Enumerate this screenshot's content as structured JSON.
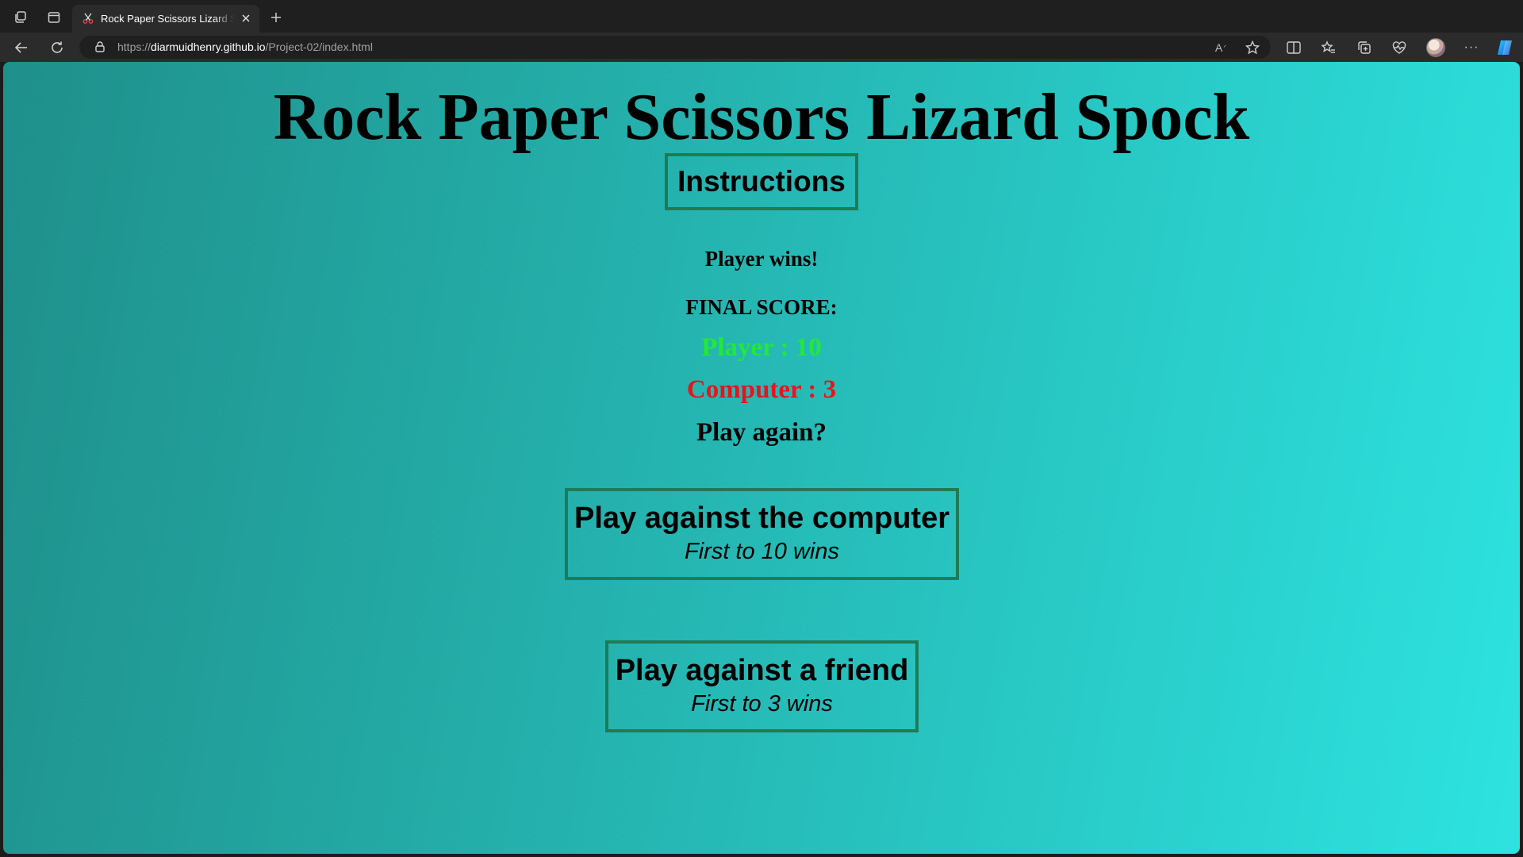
{
  "browser": {
    "tab_title": "Rock Paper Scissors Lizard Spock",
    "url_scheme": "https://",
    "url_host": "diarmuidhenry.github.io",
    "url_path": "/Project-02/index.html",
    "icons": {
      "workspaces": "workspaces-icon",
      "tab_actions": "tab-actions-icon",
      "new_tab": "+",
      "close_tab": "×",
      "back": "←",
      "refresh": "↻",
      "read_aloud": "A",
      "favorite": "☆",
      "split_screen": "split-screen-icon",
      "favorites": "favorites-icon",
      "collections": "collections-icon",
      "performance": "heart-pulse-icon",
      "more": "···"
    }
  },
  "page": {
    "title": "Rock Paper Scissors Lizard Spock",
    "instructions_label": "Instructions",
    "result_text": "Player wins!",
    "final_score_label": "FINAL SCORE:",
    "player_score_text": "Player : 10",
    "computer_score_text": "Computer : 3",
    "play_again_text": "Play again?",
    "modes": [
      {
        "title": "Play against the computer",
        "subtitle": "First to 10 wins"
      },
      {
        "title": "Play against a friend",
        "subtitle": "First to 3 wins"
      }
    ]
  },
  "scores": {
    "player": 10,
    "computer": 3
  },
  "colors": {
    "player_score": "#22e83a",
    "computer_score": "#e8141c",
    "button_border": "#227a55",
    "background_start": "#1f8f8a",
    "background_end": "#2de3e0"
  }
}
